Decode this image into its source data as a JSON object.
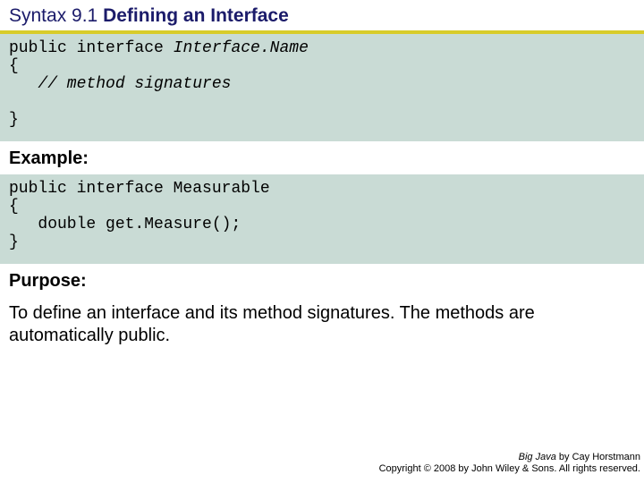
{
  "title": {
    "prefix": "Syntax 9.1 ",
    "main": "Defining an Interface"
  },
  "code1": {
    "l1a": "public interface ",
    "l1b": "Interface.Name",
    "l2": "{",
    "l3a": "   ",
    "l3b": "// method signatures",
    "l4": "}"
  },
  "example_heading": "Example:",
  "code2": {
    "l1": "public interface Measurable",
    "l2": "{",
    "l3": "   double get.Measure();",
    "l4": "}"
  },
  "purpose_heading": "Purpose:",
  "purpose_text": "To define an interface and its method signatures. The methods are automatically public.",
  "footer": {
    "line1a": "Big Java",
    "line1b": " by Cay Horstmann",
    "line2": "Copyright © 2008 by John Wiley & Sons. All rights reserved."
  }
}
